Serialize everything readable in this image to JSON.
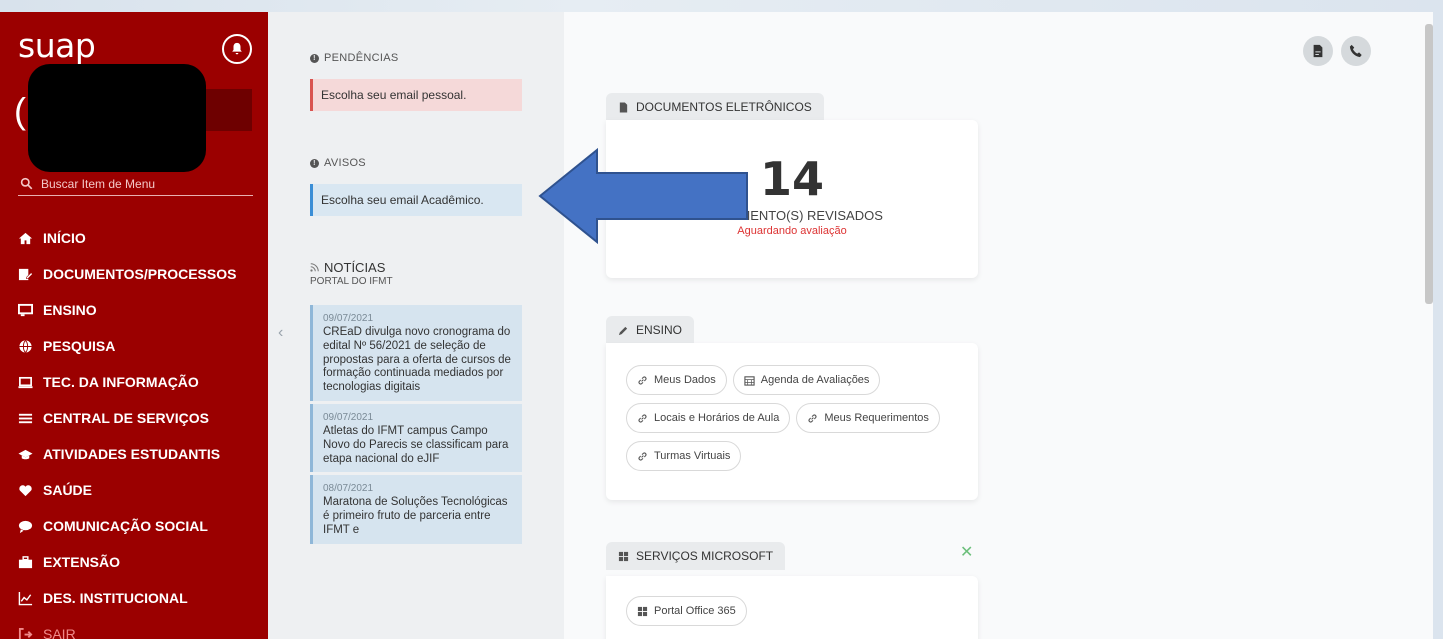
{
  "sidebar": {
    "brand": "suap",
    "search_placeholder": "Buscar Item de Menu",
    "menu": [
      {
        "label": "INÍCIO",
        "icon": "home-icon"
      },
      {
        "label": "DOCUMENTOS/PROCESSOS",
        "icon": "edit-document-icon"
      },
      {
        "label": "ENSINO",
        "icon": "chalkboard-icon"
      },
      {
        "label": "PESQUISA",
        "icon": "globe-icon"
      },
      {
        "label": "TEC. DA INFORMAÇÃO",
        "icon": "laptop-icon"
      },
      {
        "label": "CENTRAL DE SERVIÇOS",
        "icon": "list-icon"
      },
      {
        "label": "ATIVIDADES ESTUDANTIS",
        "icon": "graduation-cap-icon"
      },
      {
        "label": "SAÚDE",
        "icon": "heart-icon"
      },
      {
        "label": "COMUNICAÇÃO SOCIAL",
        "icon": "comment-icon"
      },
      {
        "label": "EXTENSÃO",
        "icon": "briefcase-icon"
      },
      {
        "label": "DES. INSTITUCIONAL",
        "icon": "chart-icon"
      },
      {
        "label": "SAIR",
        "icon": "sign-out-icon"
      }
    ]
  },
  "pendencias": {
    "title": "PENDÊNCIAS",
    "item": "Escolha seu email pessoal."
  },
  "avisos": {
    "title": "AVISOS",
    "item": "Escolha seu email Acadêmico."
  },
  "noticias": {
    "title": "NOTÍCIAS",
    "subtitle": "PORTAL DO IFMT",
    "items": [
      {
        "date": "09/07/2021",
        "title": "CREaD divulga novo cronograma do edital Nº 56/2021 de seleção de propostas para a oferta de cursos de formação continuada mediados por tecnologias digitais"
      },
      {
        "date": "09/07/2021",
        "title": "Atletas do IFMT campus Campo Novo do Parecis se classificam para etapa nacional do eJIF"
      },
      {
        "date": "08/07/2021",
        "title": "Maratona de Soluções Tecnológicas é primeiro fruto de parceria entre IFMT e"
      }
    ]
  },
  "documentos": {
    "tab": "DOCUMENTOS ELETRÔNICOS",
    "count": "14",
    "label": "DOCUMENTO(S) REVISADOS",
    "status": "Aguardando avaliação"
  },
  "ensino": {
    "tab": "ENSINO",
    "links": [
      {
        "label": "Meus Dados",
        "icon": "link-icon"
      },
      {
        "label": "Agenda de Avaliações",
        "icon": "calendar-icon"
      },
      {
        "label": "Locais e Horários de Aula",
        "icon": "link-icon"
      },
      {
        "label": "Meus Requerimentos",
        "icon": "link-icon"
      },
      {
        "label": "Turmas Virtuais",
        "icon": "link-icon"
      }
    ]
  },
  "microsoft": {
    "tab": "SERVIÇOS MICROSOFT",
    "links": [
      {
        "label": "Portal Office 365",
        "icon": "windows-icon"
      }
    ]
  },
  "colors": {
    "sidebar": "#9b0000",
    "arrow": "#4472c4"
  }
}
